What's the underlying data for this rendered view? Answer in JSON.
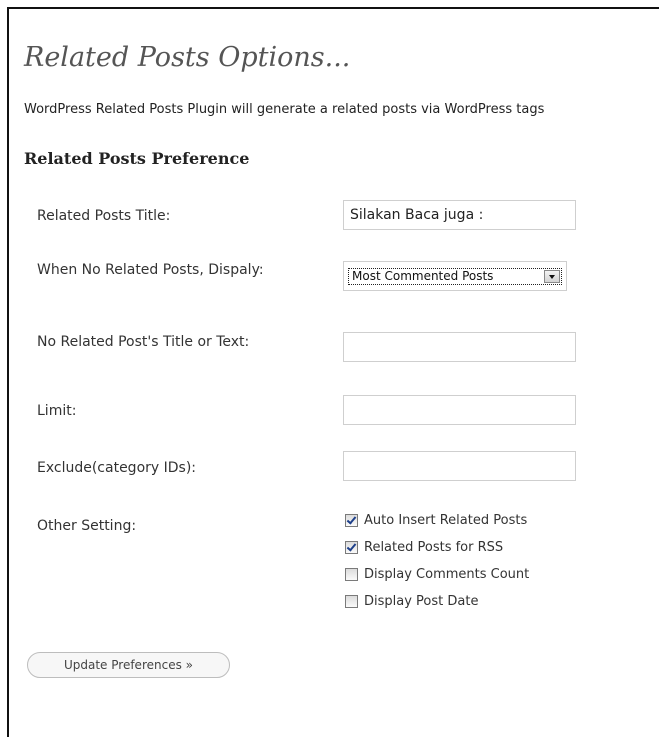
{
  "page": {
    "title": "Related Posts Options...",
    "description": "WordPress Related Posts Plugin will generate a related posts via WordPress tags",
    "section_title": "Related Posts Preference"
  },
  "form": {
    "related_title": {
      "label": "Related Posts Title:",
      "value": "Silakan Baca juga :"
    },
    "no_related_display": {
      "label": "When No Related Posts, Dispaly:",
      "selected": "Most Commented Posts"
    },
    "no_related_text": {
      "label": "No Related Post's Title or Text:",
      "value": ""
    },
    "limit": {
      "label": "Limit:",
      "value": ""
    },
    "exclude": {
      "label": "Exclude(category IDs):",
      "value": ""
    },
    "other_setting": {
      "label": "Other Setting:",
      "options": [
        {
          "label": "Auto Insert Related Posts",
          "checked": true
        },
        {
          "label": "Related Posts for RSS",
          "checked": true
        },
        {
          "label": "Display Comments Count",
          "checked": false
        },
        {
          "label": "Display Post Date",
          "checked": false
        }
      ]
    },
    "submit_label": "Update Preferences »"
  },
  "icons": {
    "select_arrow": "chevron-down-icon",
    "checkbox": "checkbox-icon"
  }
}
